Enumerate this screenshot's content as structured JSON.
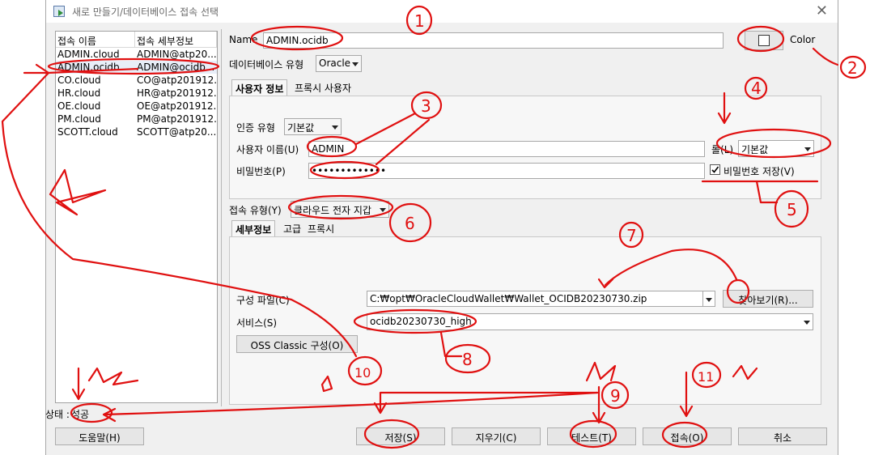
{
  "window": {
    "title": "새로 만들기/데이터베이스 접속 선택",
    "close": "✕"
  },
  "connections": {
    "headers": [
      "접속 이름",
      "접속 세부정보"
    ],
    "rows": [
      [
        "ADMIN.cloud",
        "ADMIN@atp20..."
      ],
      [
        "ADMIN.ocidb",
        "ADMIN@ocidb..."
      ],
      [
        "CO.cloud",
        "CO@atp201912..."
      ],
      [
        "HR.cloud",
        "HR@atp201912..."
      ],
      [
        "OE.cloud",
        "OE@atp201912..."
      ],
      [
        "PM.cloud",
        "PM@atp201912..."
      ],
      [
        "SCOTT.cloud",
        "SCOTT@atp20..."
      ]
    ],
    "selected_index": 1
  },
  "form": {
    "name_label": "Name",
    "name_value": "ADMIN.ocidb",
    "color_label": "Color",
    "db_type_label": "데이터베이스 유형",
    "db_type_value": "Oracle",
    "tabs": [
      "사용자 정보",
      "프록시 사용자"
    ],
    "auth_type_label": "인증 유형",
    "auth_type_value": "기본값",
    "username_label": "사용자 이름(U)",
    "username_value": "ADMIN",
    "password_label": "비밀번호(P)",
    "password_value": "•••••••••••••",
    "role_label": "롤(L)",
    "role_value": "기본값",
    "save_password_label": "비밀번호 저장(V)",
    "save_password_checked": true,
    "conn_type_label": "접속 유형(Y)",
    "conn_type_value": "클라우드 전자 지갑",
    "sub_tabs": [
      "세부정보",
      "고급",
      "프록시"
    ],
    "config_file_label": "구성 파일(C)",
    "config_file_value": "C:₩opt₩OracleCloudWallet₩Wallet_OCIDB20230730.zip",
    "browse_label": "찾아보기(R)...",
    "service_label": "서비스(S)",
    "service_value": "ocidb20230730_high",
    "oss_button": "OSS Classic 구성(O)"
  },
  "status": {
    "label": "상태 :",
    "value": "성공"
  },
  "buttons": {
    "help": "도움말(H)",
    "save": "저장(S)",
    "clear": "지우기(C)",
    "test": "테스트(T)",
    "connect": "접속(O)",
    "cancel": "취소"
  },
  "annotation_labels": [
    "1",
    "2",
    "3",
    "4",
    "5",
    "6",
    "7",
    "8",
    "9",
    "10",
    "11"
  ],
  "colors": {
    "annotation": "#e01010",
    "window_bg": "#f0f0f0"
  }
}
